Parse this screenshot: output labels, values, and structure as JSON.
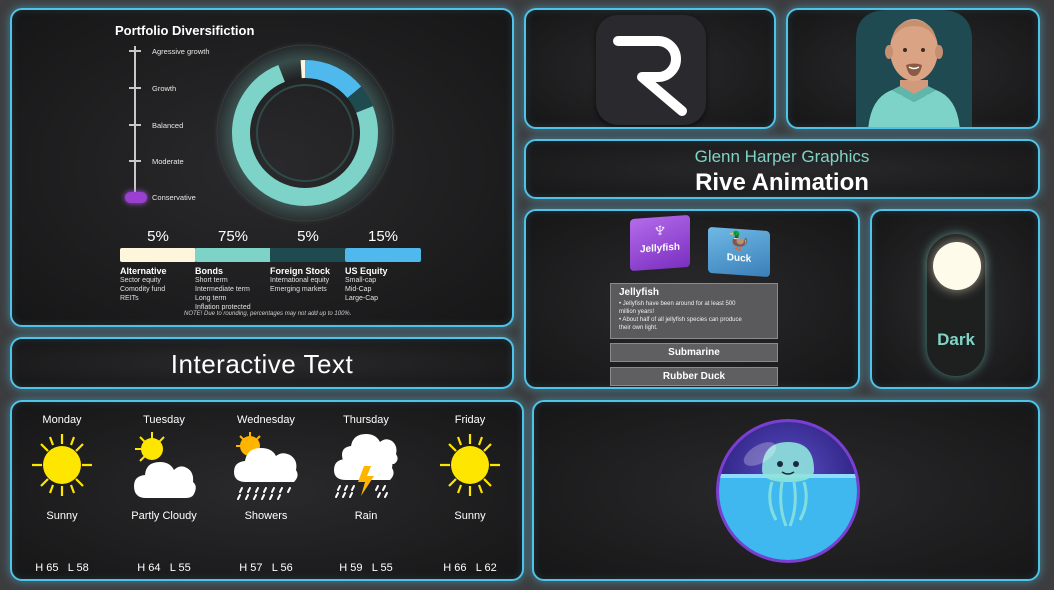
{
  "portfolio": {
    "title": "Portfolio Diversifiction",
    "levels": [
      "Agressive growth",
      "Growth",
      "Balanced",
      "Moderate",
      "Conservative"
    ],
    "selected_level": "Conservative",
    "allocations": [
      {
        "pct": "5%",
        "name": "Alternative",
        "color": "#fdf6dc",
        "items": [
          "Sector equity",
          "Comodity fund",
          "REITs"
        ]
      },
      {
        "pct": "75%",
        "name": "Bonds",
        "color": "#7dd3c7",
        "items": [
          "Short term",
          "Intermediate term",
          "Long term",
          "Inflation protected"
        ]
      },
      {
        "pct": "5%",
        "name": "Foreign Stock",
        "color": "#1f4a4f",
        "items": [
          "International equity",
          "Emerging markets"
        ]
      },
      {
        "pct": "15%",
        "name": "US Equity",
        "color": "#4fb8ec",
        "items": [
          "Small-cap",
          "Mid-Cap",
          "Large-Cap"
        ]
      }
    ],
    "note": "NOTE! Due to rounding, percentages may not add up to 100%."
  },
  "header": {
    "subtitle": "Glenn Harper Graphics",
    "title": "Rive Animation"
  },
  "jelly": {
    "folders": [
      "Jellyfish",
      "Duck"
    ],
    "card_title": "Jellyfish",
    "facts": [
      "• Jellyfish have been around for at least 500",
      "million years!",
      "• About half of all jellyfish species can produce",
      "their own light."
    ],
    "options": [
      "Submarine",
      "Rubber Duck"
    ]
  },
  "toggle": {
    "label": "Dark"
  },
  "interactive_text": "Interactive Text",
  "weather": [
    {
      "day": "Monday",
      "cond": "Sunny",
      "icon": "sun-icon",
      "hi": "H 65",
      "lo": "L 58"
    },
    {
      "day": "Tuesday",
      "cond": "Partly Cloudy",
      "icon": "partly-cloudy-icon",
      "hi": "H 64",
      "lo": "L 55"
    },
    {
      "day": "Wednesday",
      "cond": "Showers",
      "icon": "showers-icon",
      "hi": "H 57",
      "lo": "L 56"
    },
    {
      "day": "Thursday",
      "cond": "Rain",
      "icon": "thunder-rain-icon",
      "hi": "H 59",
      "lo": "L 55"
    },
    {
      "day": "Friday",
      "cond": "Sunny",
      "icon": "sun-icon",
      "hi": "H 66",
      "lo": "L 62"
    }
  ],
  "colors": {
    "accent": "#4fc3e8",
    "teal": "#7fd3c7",
    "purple": "#9b3fd0",
    "sun": "#ffe600"
  }
}
